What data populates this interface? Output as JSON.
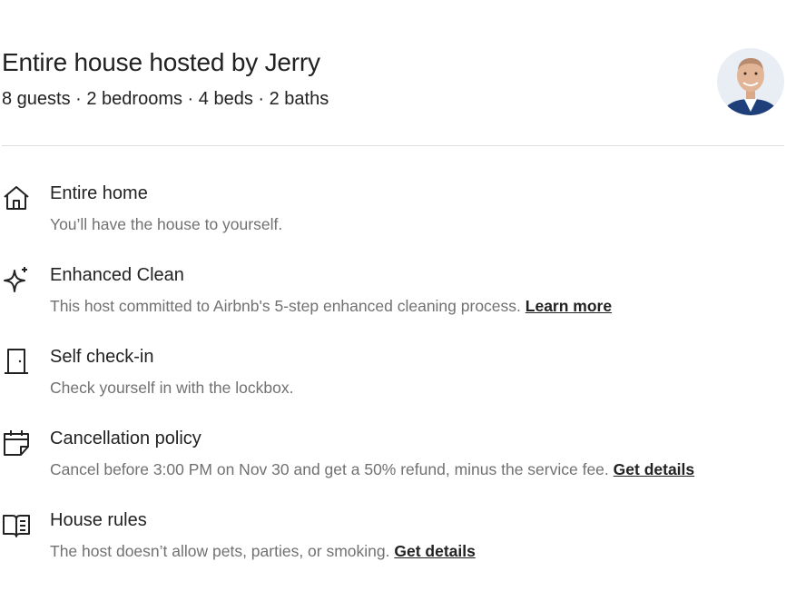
{
  "header": {
    "title": "Entire house hosted by Jerry",
    "subtitle": "8 guests · 2 bedrooms · 4 beds · 2 baths",
    "avatar_icon": "host-avatar-photo"
  },
  "features": [
    {
      "icon": "house-icon",
      "title": "Entire home",
      "description": "You’ll have the house to yourself.",
      "link": ""
    },
    {
      "icon": "sparkle-icon",
      "title": "Enhanced Clean",
      "description": "This host committed to Airbnb's 5-step enhanced cleaning process. ",
      "link": "Learn more"
    },
    {
      "icon": "door-icon",
      "title": "Self check-in",
      "description": "Check yourself in with the lockbox.",
      "link": ""
    },
    {
      "icon": "calendar-icon",
      "title": "Cancellation policy",
      "description": "Cancel before 3:00 PM on Nov 30 and get a 50% refund, minus the service fee. ",
      "link": "Get details"
    },
    {
      "icon": "book-icon",
      "title": "House rules",
      "description": "The host doesn’t allow pets, parties, or smoking. ",
      "link": "Get details"
    }
  ],
  "colors": {
    "text_primary": "#222222",
    "text_secondary": "#717171",
    "divider": "#dddddd",
    "avatar_background": "#e9eef5",
    "avatar_shirt": "#1f3f7a"
  }
}
